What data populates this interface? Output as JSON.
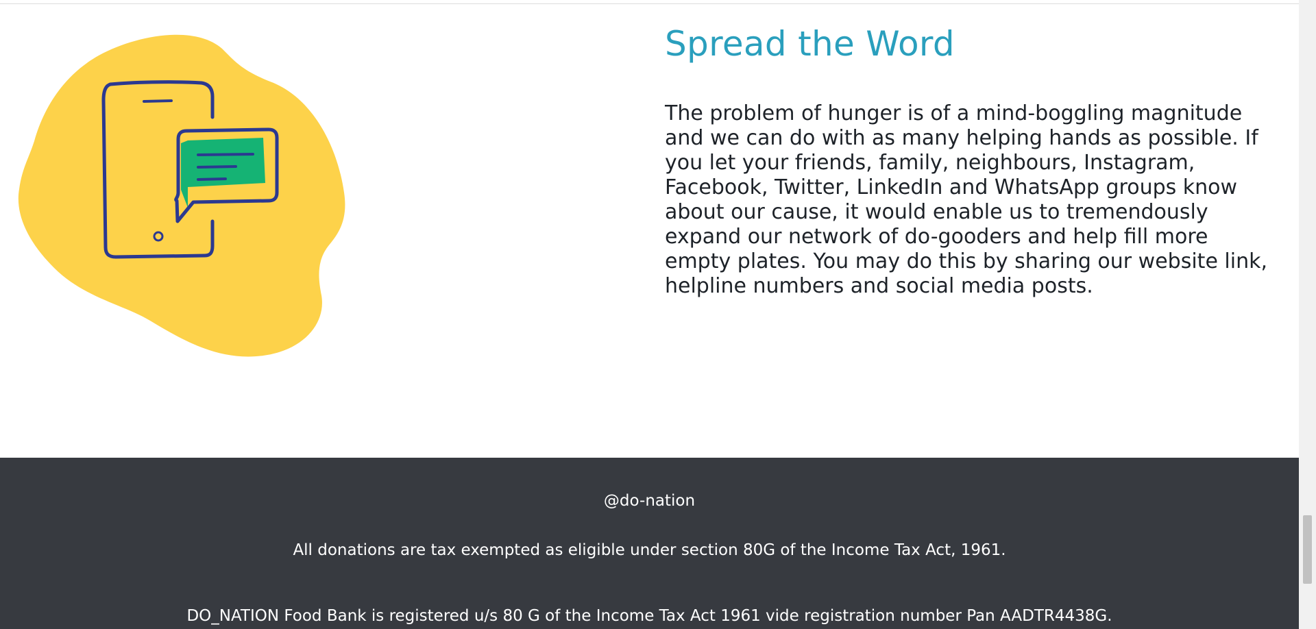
{
  "section": {
    "title": "Spread the Word",
    "body": "The problem of hunger is of a mind-boggling magnitude and we can do with as many helping hands as possible. If you let your friends, family, neighbours, Instagram, Facebook, Twitter, LinkedIn and WhatsApp groups know about our cause, it would enable us to tremendously expand our network of do-gooders and help fill more empty plates. You may do this by sharing our website link, helpline numbers and social media posts."
  },
  "illustration": {
    "icon": "phone-chat-icon",
    "colors": {
      "blob": "#fdd24a",
      "outline": "#2b3990",
      "bubble": "#15b374"
    }
  },
  "footer": {
    "handle": "@do-nation",
    "tax_note": "All donations are tax exempted as eligible under section 80G of the Income Tax Act, 1961.",
    "registration": "DO_NATION Food Bank is registered u/s 80 G of the Income Tax Act 1961 vide registration number Pan AADTR4438G.",
    "background": "#373a40"
  },
  "colors": {
    "title": "#2a9fbd",
    "body_text": "#1d2228"
  }
}
